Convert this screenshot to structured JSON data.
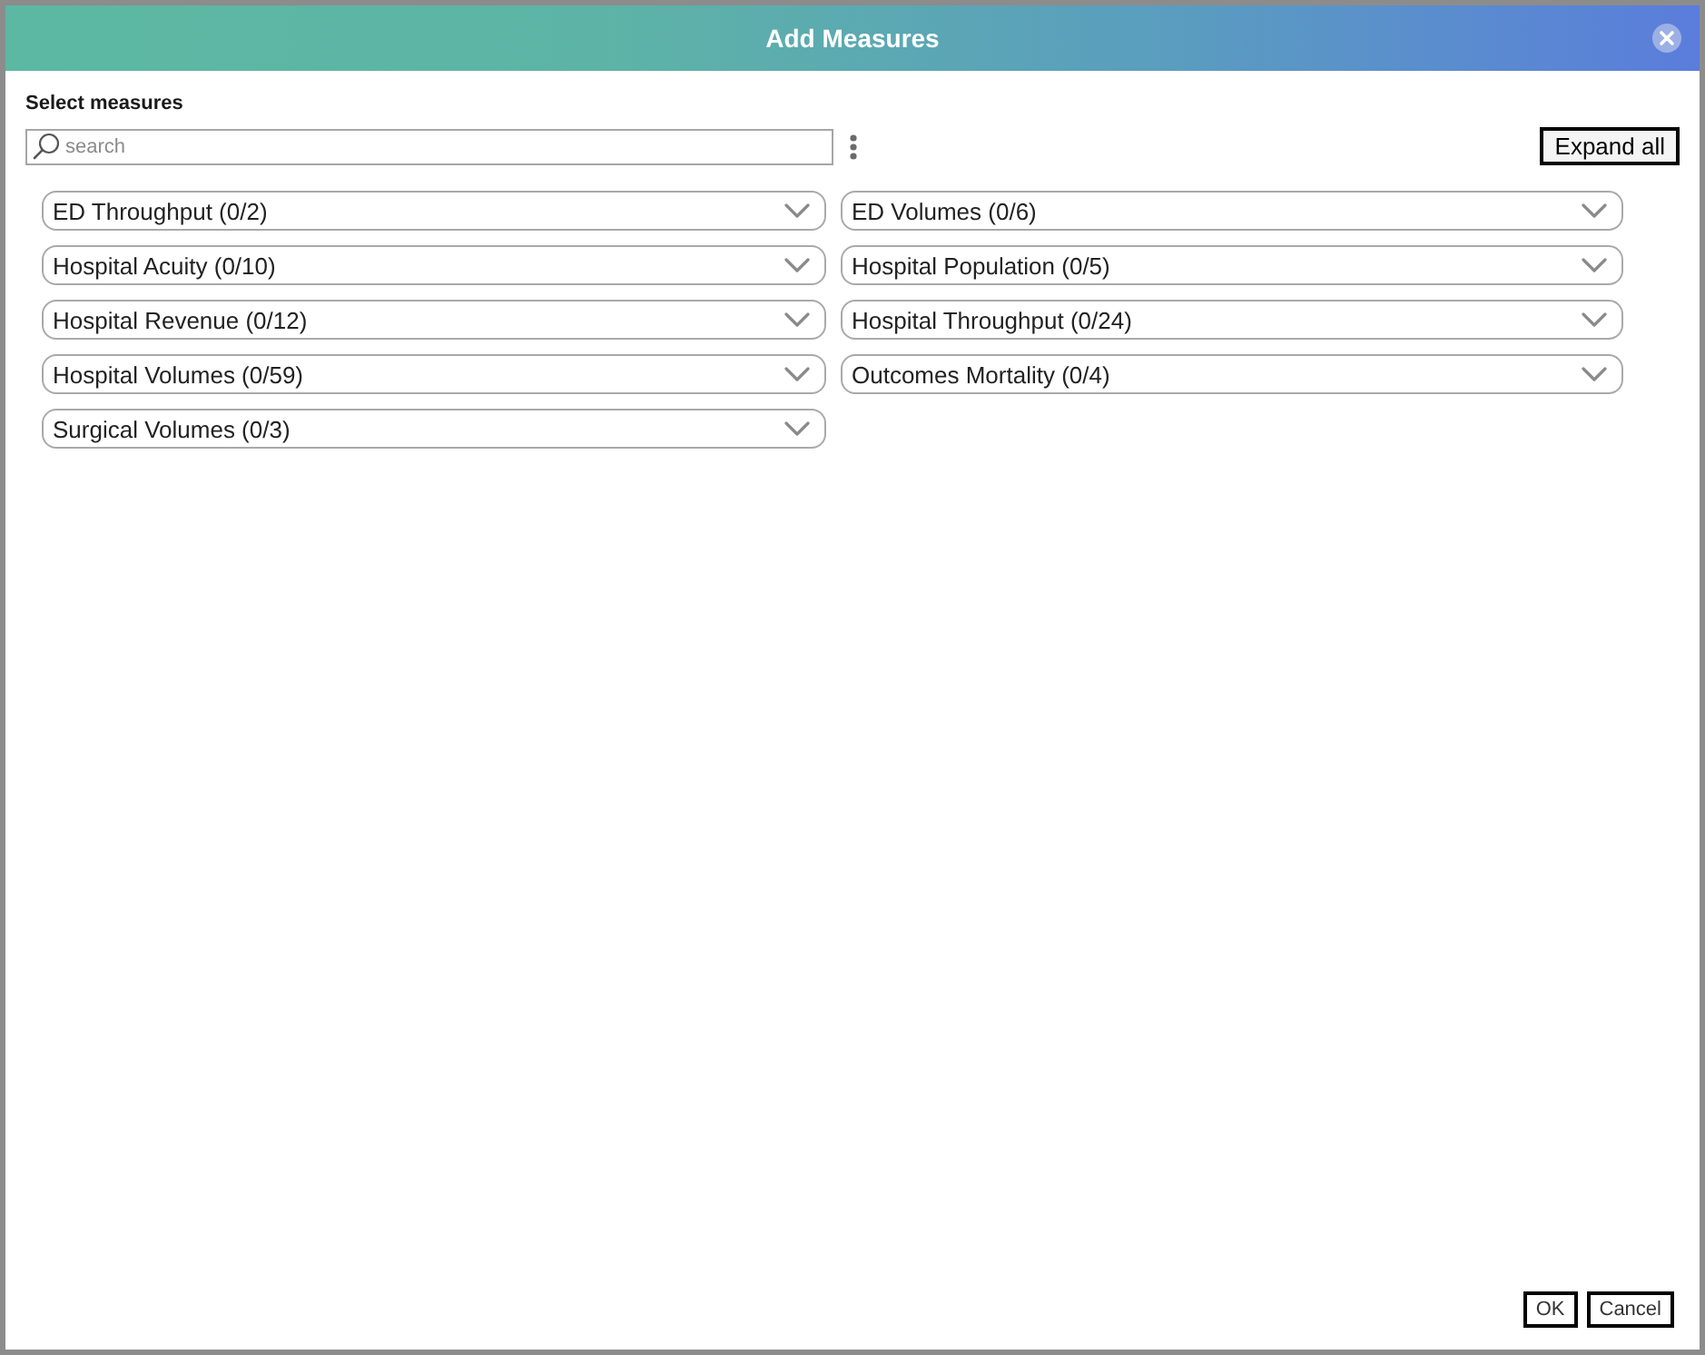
{
  "window": {
    "title": "Add Measures"
  },
  "search": {
    "label": "Select measures",
    "placeholder": "search"
  },
  "expand_all": "Expand all",
  "groups": [
    {
      "label": "ED Throughput (0/2)",
      "expanded": false
    },
    {
      "label": "ED Volumes (0/6)",
      "expanded": false
    },
    {
      "label": "Hospital Acuity (0/10)",
      "expanded": false
    },
    {
      "label": "Hospital Population (0/5)",
      "expanded": false
    },
    {
      "label": "Hospital Revenue (0/12)",
      "expanded": false
    },
    {
      "label": "Hospital Throughput (0/24)",
      "expanded": false
    },
    {
      "label": "Hospital Volumes (0/59)",
      "expanded": false
    },
    {
      "label": "Outcomes Mortality (0/4)",
      "expanded": false
    },
    {
      "label": "Surgical Volumes (0/3)",
      "expanded": false
    }
  ],
  "buttons": [
    "OK",
    "Cancel"
  ]
}
